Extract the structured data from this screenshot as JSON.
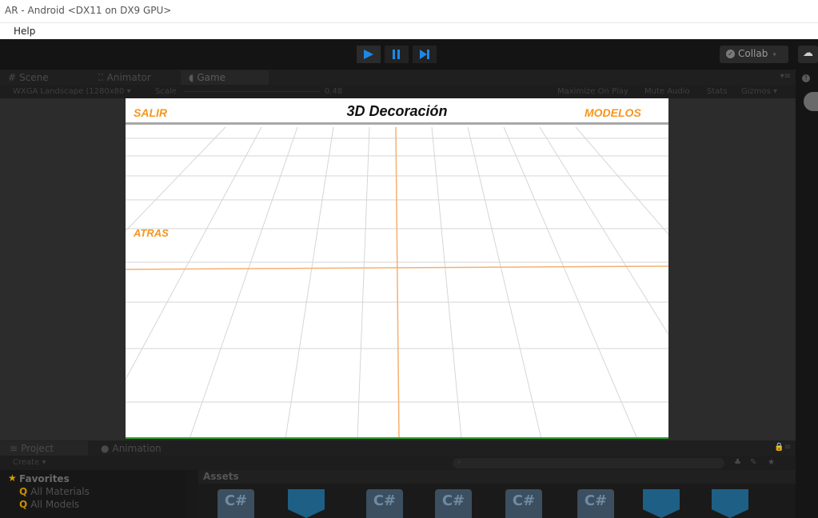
{
  "window": {
    "title": "AR - Android <DX11 on DX9 GPU>"
  },
  "menubar": {
    "items": [
      "Help"
    ]
  },
  "toolbar": {
    "play_icon": "play-icon",
    "pause_icon": "pause-icon",
    "step_icon": "step-icon",
    "collab_label": "Collab",
    "accent": "#1e88e5"
  },
  "tabs": [
    {
      "label": "Scene",
      "icon": "hash-icon"
    },
    {
      "label": "Animator",
      "icon": "animator-icon"
    },
    {
      "label": "Game",
      "icon": "pacman-icon"
    }
  ],
  "gamebar": {
    "resolution": "WXGA Landscape (1280x80",
    "scale_label": "Scale",
    "scale_value": "0.48",
    "maximize_label": "Maximize On Play",
    "mute_label": "Mute Audio",
    "stats_label": "Stats",
    "gizmos_label": "Gizmos"
  },
  "game": {
    "title": "3D Decoración",
    "left_button": "SALIR",
    "right_button": "MODELOS",
    "back_button": "ATRAS",
    "ui_color": "#f5961e"
  },
  "bottom_tabs": [
    {
      "label": "Project",
      "icon": "list-icon"
    },
    {
      "label": "Animation",
      "icon": "clock-icon"
    }
  ],
  "project": {
    "create_label": "Create",
    "favorites_label": "Favorites",
    "favorites": [
      "All Materials",
      "All Models"
    ],
    "assets_label": "Assets",
    "asset_tiles": [
      "C#",
      "cube",
      "C#",
      "C#",
      "C#",
      "C#",
      "cube",
      "cube"
    ]
  }
}
